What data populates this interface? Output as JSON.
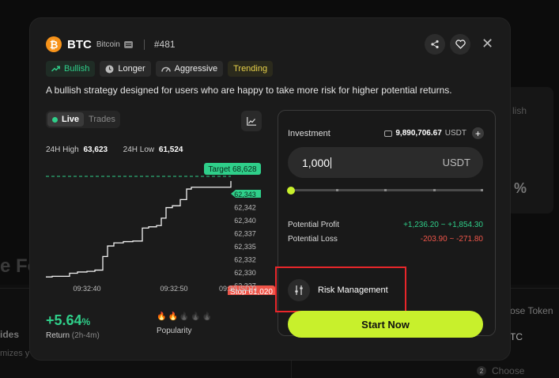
{
  "background": {
    "texts": [
      "e Fo",
      "ides",
      "mizes y",
      "lish",
      "%",
      "ose Token",
      "TC",
      "Choose Directio"
    ],
    "step": "2"
  },
  "header": {
    "symbol": "BTC",
    "coin_name": "Bitcoin",
    "strategy_id": "#481"
  },
  "tags": [
    {
      "label": "Bullish",
      "icon": "trend-up-icon"
    },
    {
      "label": "Longer",
      "icon": "clock-icon"
    },
    {
      "label": "Aggressive",
      "icon": "speedometer-icon"
    },
    {
      "label": "Trending",
      "icon": ""
    }
  ],
  "description": "A bullish strategy designed for users who are happy to take more risk for higher potential returns.",
  "chart_tabs": {
    "live": "Live",
    "trades": "Trades"
  },
  "stats": {
    "high_label": "24H High",
    "high": "63,623",
    "low_label": "24H Low",
    "low": "61,524"
  },
  "chart_data": {
    "type": "line",
    "x_ticks": [
      "09:32:40",
      "09:32:50",
      "09:3(USDT)"
    ],
    "y_ticks": [
      "62,343",
      "62,342",
      "62,340",
      "62,337",
      "62,335",
      "62,332",
      "62,330",
      "62,327"
    ],
    "target_label": "Target 68,628",
    "stop_label": "Stop 61,020",
    "current_label": "62,343",
    "series": [
      {
        "values": [
          62327.5,
          62327.6,
          62327.6,
          62328.1,
          62328.3,
          62328.4,
          62328.6,
          62330.8,
          62332.5,
          62333.0,
          62333.2,
          62333.3,
          62335.4,
          62335.6,
          62335.8,
          62337.0,
          62338.7,
          62339.0,
          62340.0,
          62341.7,
          62342.0,
          62343.0
        ]
      }
    ]
  },
  "returns": {
    "value": "+5.64",
    "unit": "%",
    "label": "Return",
    "period": "(2h-4m)"
  },
  "popularity": {
    "label": "Popularity",
    "level": 2,
    "max": 5
  },
  "investment": {
    "label": "Investment",
    "balance": "9,890,706.67",
    "balance_unit": "USDT",
    "value": "1,000",
    "currency": "USDT",
    "slider_fraction": 0,
    "profit_label": "Potential Profit",
    "profit": "+1,236.20 ~ +1,854.30",
    "loss_label": "Potential Loss",
    "loss": "-203.90 ~ -271.80"
  },
  "risk_management": "Risk Management",
  "start_button": "Start Now",
  "colors": {
    "accent": "#c8f02c",
    "positive": "#2fcf8a",
    "negative": "#f0564a",
    "highlight": "#e8262a"
  }
}
